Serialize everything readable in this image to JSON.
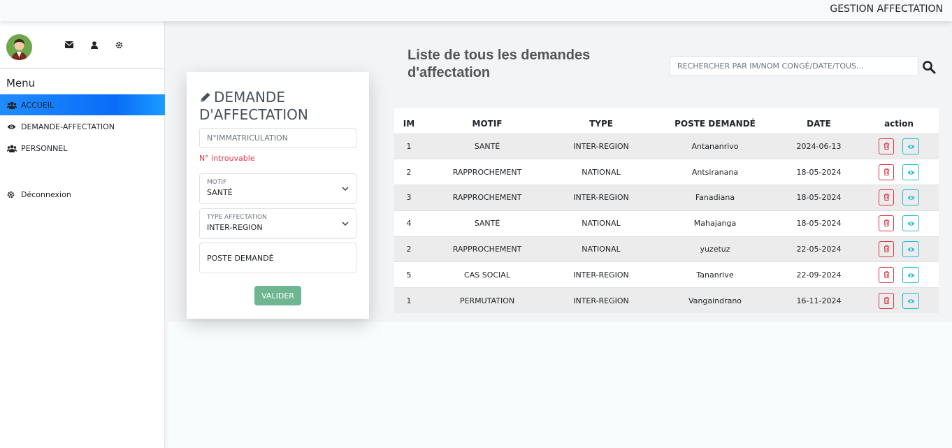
{
  "header": {
    "title": "GESTION AFFECTATION"
  },
  "sidebar": {
    "icons": [
      "envelope-icon",
      "user-icon",
      "gear-icon"
    ],
    "menu_title": "Menu",
    "items": [
      {
        "label": "ACCUEIL",
        "icon": "users-icon",
        "active": true
      },
      {
        "label": "DEMANDE-AFFECTATION",
        "icon": "eye-icon",
        "active": false
      },
      {
        "label": "PERSONNEL",
        "icon": "users-icon",
        "active": false
      }
    ],
    "logout": {
      "label": "Déconnexion",
      "icon": "gear-icon"
    }
  },
  "form": {
    "title": "DEMANDE D'AFFECTATION",
    "matricule_placeholder": "N°IMMATRICULATION",
    "error": "N° introuvable",
    "motif": {
      "label": "MOTIF",
      "value": "SANTÉ"
    },
    "type": {
      "label": "TYPE AFFECTATION",
      "value": "INTER-REGION"
    },
    "poste_placeholder": "POSTE DEMANDÉ",
    "submit": "VALIDER"
  },
  "list": {
    "title": "Liste de tous les demandes d'affectation",
    "search_placeholder": "RECHERCHER PAR IM/NOM CONGÉ/DATE/TOUS...",
    "columns": [
      "IM",
      "MOTIF",
      "TYPE",
      "POSTE DEMANDÉ",
      "DATE",
      "action"
    ],
    "rows": [
      {
        "im": "1",
        "motif": "SANTÉ",
        "type": "INTER-REGION",
        "poste": "Antananrivo",
        "date": "2024-06-13"
      },
      {
        "im": "2",
        "motif": "RAPPROCHEMENT",
        "type": "NATIONAL",
        "poste": "Antsiranana",
        "date": "18-05-2024"
      },
      {
        "im": "3",
        "motif": "RAPPROCHEMENT",
        "type": "INTER-REGION",
        "poste": "Fanadiana",
        "date": "18-05-2024"
      },
      {
        "im": "4",
        "motif": "SANTÉ",
        "type": "NATIONAL",
        "poste": "Mahajanga",
        "date": "18-05-2024"
      },
      {
        "im": "2",
        "motif": "RAPPROCHEMENT",
        "type": "NATIONAL",
        "poste": "yuzetuz",
        "date": "22-05-2024"
      },
      {
        "im": "5",
        "motif": "CAS SOCIAL",
        "type": "INTER-REGION",
        "poste": "Tananrive",
        "date": "22-09-2024"
      },
      {
        "im": "1",
        "motif": "PERMUTATION",
        "type": "INTER-REGION",
        "poste": "Vangaindrano",
        "date": "16-11-2024"
      }
    ]
  },
  "colors": {
    "accent": "#0a6cf7",
    "success": "#6eb592",
    "danger": "#dc3545",
    "info": "#22b9d6"
  }
}
